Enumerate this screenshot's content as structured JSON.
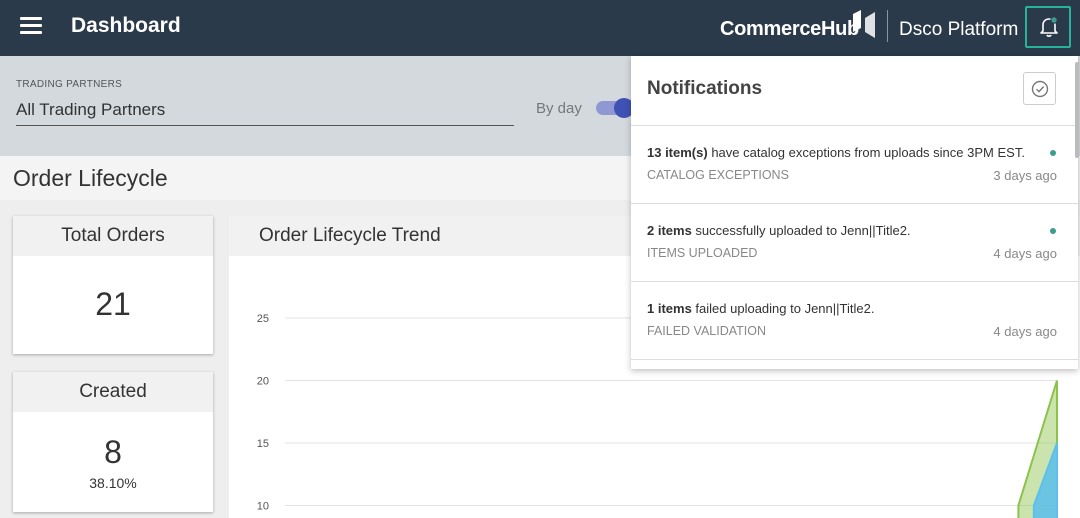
{
  "header": {
    "title": "Dashboard",
    "brand": "CommerceHub",
    "platform": "Dsco Platform"
  },
  "filters": {
    "trading_partners_label": "TRADING PARTNERS",
    "trading_partners_value": "All Trading Partners",
    "by_day_label": "By day",
    "by_day_toggle_on": true
  },
  "section": {
    "title": "Order Lifecycle"
  },
  "cards": {
    "total_orders": {
      "label": "Total Orders",
      "value": "21"
    },
    "created": {
      "label": "Created",
      "value": "8",
      "percent": "38.10%"
    }
  },
  "trend": {
    "title": "Order Lifecycle Trend"
  },
  "chart_data": {
    "type": "area",
    "title": "Order Lifecycle Trend",
    "xlabel": "",
    "ylabel": "",
    "y_ticks": [
      25,
      20,
      15,
      10
    ],
    "ylim": [
      10,
      25
    ],
    "grid": true,
    "series": [
      {
        "color": "#8bc34a",
        "x": [
          0.95,
          1.0
        ],
        "values": [
          10,
          20
        ]
      },
      {
        "color": "#5bc0eb",
        "x": [
          0.97,
          1.0
        ],
        "values": [
          10,
          15
        ]
      }
    ]
  },
  "notifications": {
    "title": "Notifications",
    "items": [
      {
        "count": "13 item(s)",
        "message": " have catalog exceptions from uploads since 3PM EST.",
        "category": "CATALOG EXCEPTIONS",
        "time": "3 days ago",
        "unread": true
      },
      {
        "count": "2 items",
        "message": " successfully uploaded to Jenn||Title2.",
        "category": "ITEMS UPLOADED",
        "time": "4 days ago",
        "unread": true
      },
      {
        "count": "1 items",
        "message": " failed uploading to Jenn||Title2.",
        "category": "FAILED VALIDATION",
        "time": "4 days ago",
        "unread": false
      }
    ]
  },
  "colors": {
    "topbar": "#2b3a4a",
    "accent": "#27b39b",
    "toggle": "#3f51b5",
    "unread_dot": "#3d9c8c"
  }
}
